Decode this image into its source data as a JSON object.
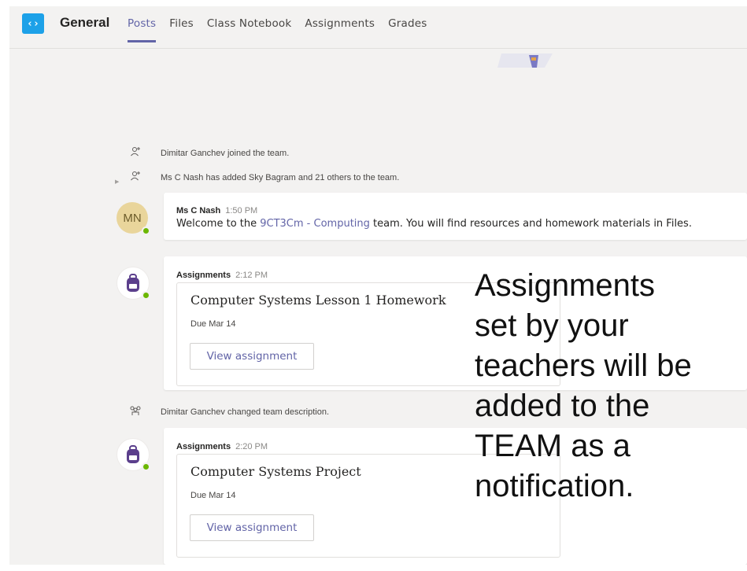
{
  "header": {
    "channel_name": "General",
    "tabs": [
      {
        "label": "Posts",
        "active": true
      },
      {
        "label": "Files",
        "active": false
      },
      {
        "label": "Class Notebook",
        "active": false
      },
      {
        "label": "Assignments",
        "active": false
      },
      {
        "label": "Grades",
        "active": false
      }
    ],
    "logo_glyph": "‹›"
  },
  "events": [
    {
      "icon": "person-add-icon",
      "text": "Dimitar Ganchev joined the team."
    },
    {
      "icon": "person-add-icon",
      "text": "Ms C Nash has added Sky Bagram and 21 others to the team."
    },
    {
      "icon": "team-icon",
      "text": "Dimitar Ganchev changed team description."
    }
  ],
  "welcome_message": {
    "avatar_initials": "MN",
    "sender": "Ms C Nash",
    "time": "1:50 PM",
    "text_before": "Welcome to the ",
    "link_text": "9CT3Cm - Computing",
    "text_after": " team. You will find resources and homework materials in Files."
  },
  "assignments": [
    {
      "sender": "Assignments",
      "time": "2:12 PM",
      "title": "Computer Systems Lesson 1 Homework",
      "due": "Due Mar 14",
      "button_label": "View assignment"
    },
    {
      "sender": "Assignments",
      "time": "2:20 PM",
      "title": "Computer Systems Project",
      "due": "Due Mar 14",
      "button_label": "View assignment"
    }
  ],
  "annotation": "Assignments\nset by your\nteachers will be\nadded to the\nTEAM as a\nnotification.",
  "colors": {
    "accent": "#6264a7",
    "presence": "#6bb700",
    "assignment_icon": "#5b3f8c"
  }
}
